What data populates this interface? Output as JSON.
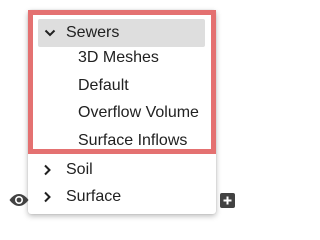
{
  "layers": {
    "expanded_group": {
      "label": "Sewers",
      "expanded": true,
      "children": [
        {
          "label": "3D Meshes"
        },
        {
          "label": "Default"
        },
        {
          "label": "Overflow Volume"
        },
        {
          "label": "Surface Inflows"
        }
      ]
    },
    "collapsed_groups": [
      {
        "label": "Soil",
        "expanded": false
      },
      {
        "label": "Surface",
        "expanded": false
      }
    ]
  },
  "icons": {
    "expand": "chevron-down-icon",
    "collapse": "chevron-right-icon",
    "visibility": "eye-icon",
    "add": "plus-box-icon"
  },
  "colors": {
    "highlight_border": "#e47171",
    "selected_row_bg": "#dedede",
    "icon": "#424242",
    "text": "#212121"
  }
}
